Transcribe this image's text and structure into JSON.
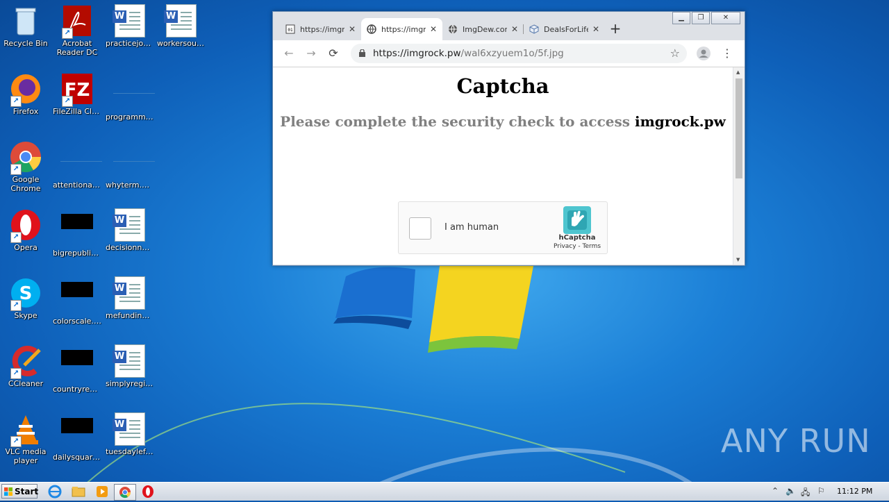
{
  "desktop": {
    "icons": [
      {
        "label": "Recycle Bin"
      },
      {
        "label": "Acrobat Reader DC"
      },
      {
        "label": "practicejour..."
      },
      {
        "label": "workersour.rtf"
      },
      {
        "label": "Firefox"
      },
      {
        "label": "FileZilla Client"
      },
      {
        "label": "programme..."
      },
      {
        "label": "Google Chrome"
      },
      {
        "label": "attentionad..."
      },
      {
        "label": "whyterm.png"
      },
      {
        "label": "Opera"
      },
      {
        "label": "bigrepublic.jpg"
      },
      {
        "label": "decisionnot.rtf"
      },
      {
        "label": "Skype"
      },
      {
        "label": "colorscale.jpg"
      },
      {
        "label": "mefunding.rtf"
      },
      {
        "label": "CCleaner"
      },
      {
        "label": "countryrep..."
      },
      {
        "label": "simplyregist..."
      },
      {
        "label": "VLC media player"
      },
      {
        "label": "dailysquare..."
      },
      {
        "label": "tuesdayleft.rtf"
      }
    ],
    "watermark": "ANY RUN"
  },
  "browser": {
    "tabs": [
      {
        "title": "https://imgr",
        "close": "✕"
      },
      {
        "title": "https://imgr",
        "close": "✕"
      },
      {
        "title": "ImgDew.com",
        "close": "✕"
      },
      {
        "title": "DealsForLife",
        "close": "✕"
      }
    ],
    "new_tab": "+",
    "url_host": "https://imgrock.pw",
    "url_path": "/wal6xzyuem1o/5f.jpg",
    "page": {
      "heading": "Captcha",
      "message": "Please complete the security check to access",
      "site": "imgrock.pw",
      "captcha": {
        "checkbox_label": "I am human",
        "brand": "hCaptcha",
        "links": "Privacy - Terms"
      }
    }
  },
  "taskbar": {
    "start_label": "Start",
    "clock": "11:12 PM"
  }
}
